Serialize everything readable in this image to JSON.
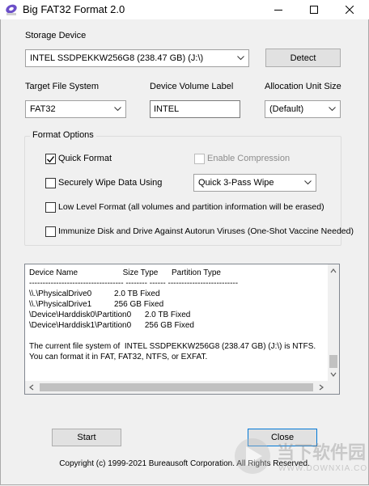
{
  "window": {
    "title": "Big FAT32 Format 2.0"
  },
  "storage": {
    "label": "Storage Device",
    "selected": "INTEL SSDPEKKW256G8 (238.47 GB) (J:\\)",
    "detect_label": "Detect"
  },
  "target_fs": {
    "label": "Target File System",
    "selected": "FAT32"
  },
  "volume_label": {
    "label": "Device Volume Label",
    "value": "INTEL"
  },
  "alloc": {
    "label": "Allocation Unit Size",
    "selected": "(Default)"
  },
  "format_options": {
    "title": "Format Options",
    "quick_format": {
      "label": "Quick Format",
      "checked": true
    },
    "enable_compression": {
      "label": "Enable Compression",
      "checked": false,
      "enabled": false
    },
    "secure_wipe": {
      "label": "Securely Wipe Data Using",
      "checked": false,
      "method": "Quick 3-Pass Wipe"
    },
    "low_level": {
      "label": "Low Level Format (all volumes and partition information will be erased)",
      "checked": false
    },
    "immunize": {
      "label": "Immunize Disk and Drive Against Autorun Viruses (One-Shot Vaccine Needed)",
      "checked": false
    }
  },
  "log": {
    "lines": [
      "Device Name                    Size Type      Partition Type",
      "----------------------------------- -------- ------ --------------------------",
      "\\\\.\\PhysicalDrive0          2.0 TB Fixed",
      "\\\\.\\PhysicalDrive1          256 GB Fixed",
      "\\Device\\Harddisk0\\Partition0      2.0 TB Fixed",
      "\\Device\\Harddisk1\\Partition0      256 GB Fixed",
      "",
      "The current file system of  INTEL SSDPEKKW256G8 (238.47 GB) (J:\\) is NTFS.",
      "You can format it in FAT, FAT32, NTFS, or EXFAT."
    ]
  },
  "actions": {
    "start_label": "Start",
    "close_label": "Close"
  },
  "footer": {
    "copyright": "Copyright (c) 1999-2021 Bureausoft Corporation. All Rights Reserved."
  },
  "watermark": {
    "text": "当下软件园",
    "domain": "WWW.DOWNXIA.COM"
  }
}
